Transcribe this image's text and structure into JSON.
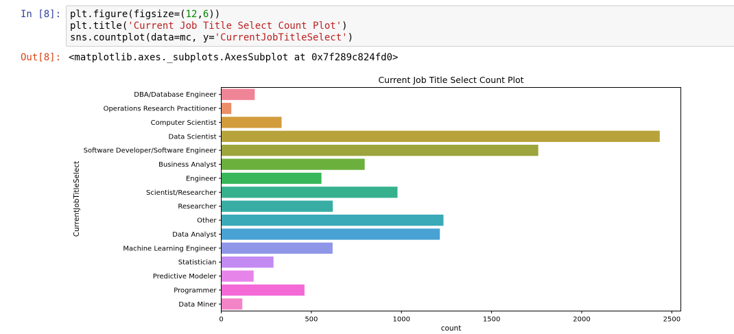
{
  "cell": {
    "in_prompt": "In [8]:",
    "out_prompt": "Out[8]:",
    "code": {
      "line1": {
        "pre": "plt.figure(figsize=(",
        "num1": "12",
        "comma": ",",
        "num2": "6",
        "post": "))"
      },
      "line2": {
        "pre": "plt.title(",
        "str": "'Current Job Title Select Count Plot'",
        "post": ")"
      },
      "line3": {
        "pre": "sns.countplot(data=mc, y=",
        "str": "'CurrentJobTitleSelect'",
        "post": ")"
      }
    },
    "output": "<matplotlib.axes._subplots.AxesSubplot at 0x7f289c824fd0>"
  },
  "chart_data": {
    "type": "bar",
    "orientation": "horizontal",
    "title": "Current Job Title Select Count Plot",
    "xlabel": "count",
    "ylabel": "CurrentJobTitleSelect",
    "xlim": [
      0,
      2550
    ],
    "xticks": [
      0,
      500,
      1000,
      1500,
      2000,
      2500
    ],
    "grid": false,
    "categories": [
      "DBA/Database Engineer",
      "Operations Research Practitioner",
      "Computer Scientist",
      "Data Scientist",
      "Software Developer/Software Engineer",
      "Business Analyst",
      "Engineer",
      "Scientist/Researcher",
      "Researcher",
      "Other",
      "Data Analyst",
      "Machine Learning Engineer",
      "Statistician",
      "Predictive Modeler",
      "Programmer",
      "Data Miner"
    ],
    "values": [
      186,
      56,
      335,
      2433,
      1759,
      796,
      556,
      978,
      619,
      1233,
      1213,
      618,
      290,
      180,
      462,
      117
    ],
    "colors": [
      "#f08497",
      "#eb8f6a",
      "#d29c3c",
      "#b7a23b",
      "#9da43b",
      "#6bb03c",
      "#38b65a",
      "#36b18e",
      "#38ada3",
      "#3aa9b8",
      "#48a2d4",
      "#8f96e8",
      "#c38af1",
      "#e784ea",
      "#f36ad7",
      "#f384c7"
    ]
  }
}
